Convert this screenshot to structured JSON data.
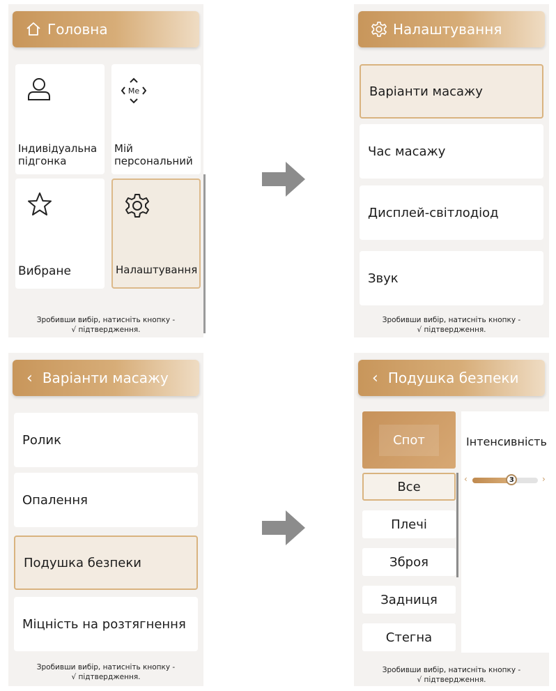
{
  "panel_home": {
    "title": "Головна",
    "tiles": [
      {
        "label": "Індивідуальна підгонка",
        "icon": "user-icon"
      },
      {
        "label": "Мій персональний",
        "icon": "me-icon",
        "icon_text": "Me"
      },
      {
        "label": "Вибране",
        "icon": "star-icon"
      },
      {
        "label": "Налаштування",
        "icon": "gear-icon"
      }
    ],
    "footer_line1": "Зробивши вибір, натисніть кнопку -",
    "footer_line2": "√ підтвердження."
  },
  "panel_settings": {
    "title": "Налаштування",
    "items": [
      "Варіанти масажу",
      "Час масажу",
      "Дисплей-світлодіод",
      "Звук"
    ],
    "footer_line1": "Зробивши вибір, натисніть кнопку -",
    "footer_line2": "√ підтвердження."
  },
  "panel_options": {
    "back_symbol": "‹",
    "title": "Варіанти масажу",
    "items": [
      "Ролик",
      "Опалення",
      "Подушка безпеки",
      "Міцність на розтягнення"
    ],
    "footer_line1": "Зробивши вибір, натисніть кнопку -",
    "footer_line2": "√ підтвердження."
  },
  "panel_airbag": {
    "back_symbol": "‹",
    "title": "Подушка безпеки",
    "mode": "Спот",
    "sub_items": [
      "Все",
      "Плечі",
      "Зброя",
      "Задниця",
      "Стегна"
    ],
    "intensity_label": "Інтенсивність",
    "intensity_value": "3",
    "intensity_fraction": 0.6,
    "footer_line1": "Зробивши вибір, натисніть кнопку -",
    "footer_line2": "√ підтвердження."
  },
  "colors": {
    "accent": "#c8965b",
    "selected_border": "#d9b37f",
    "arrow": "#8c8c8c"
  }
}
